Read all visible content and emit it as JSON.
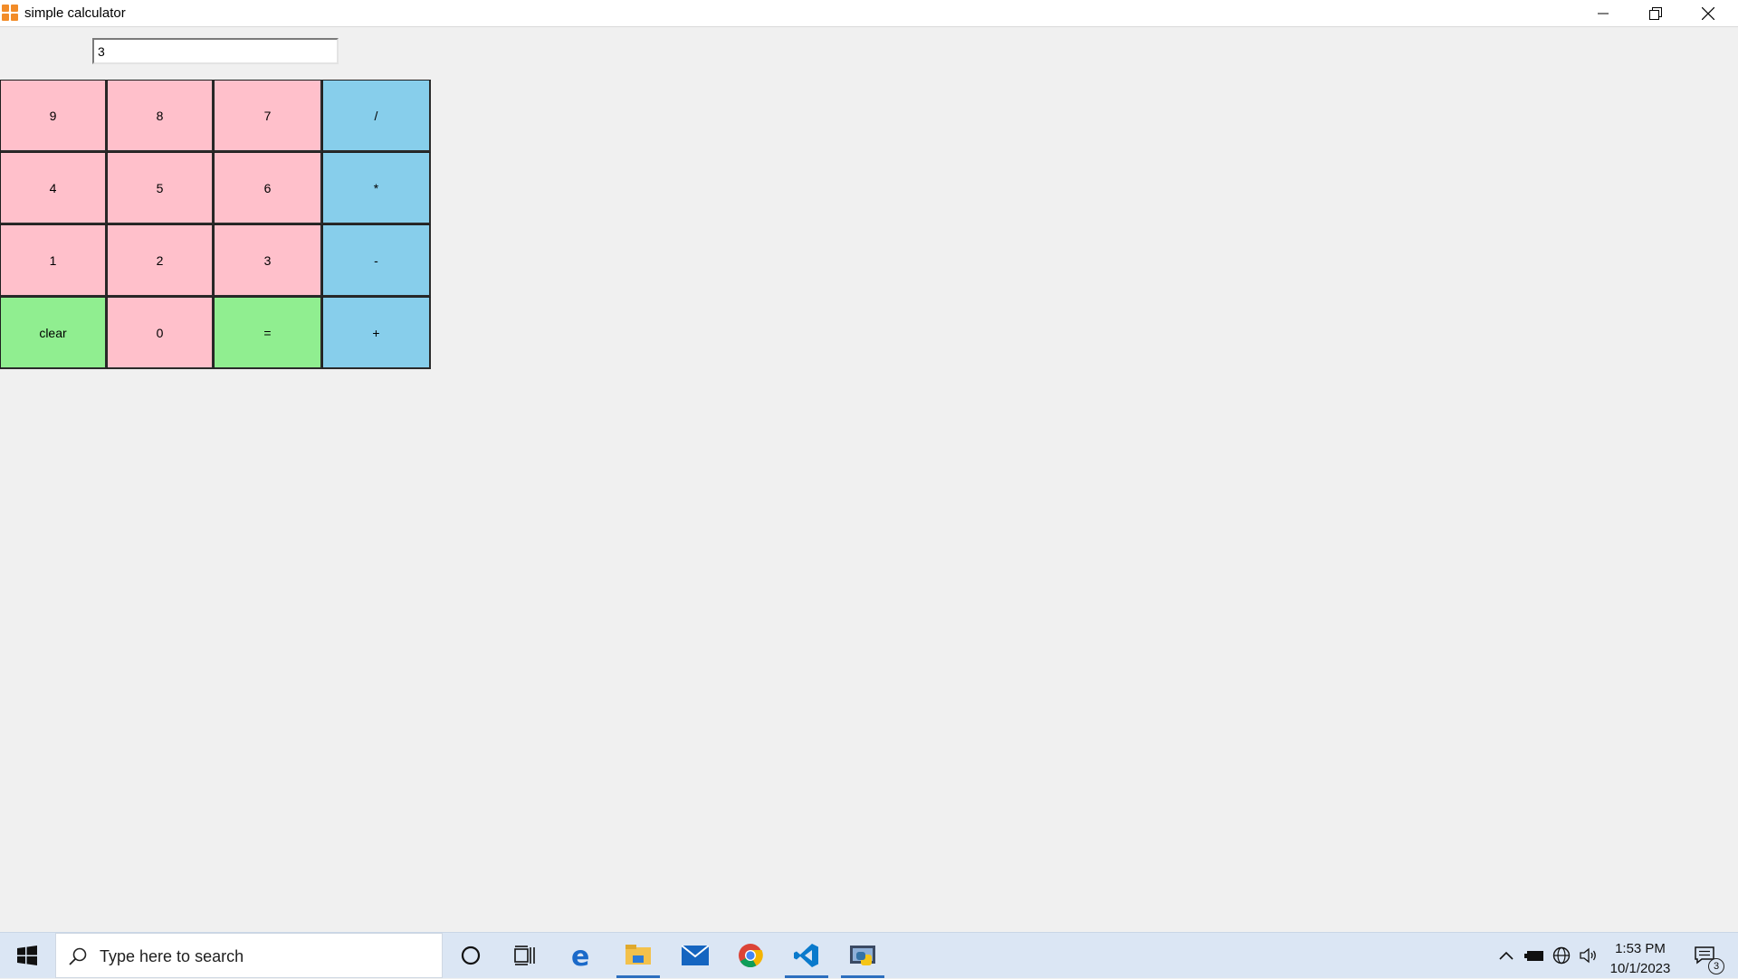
{
  "window": {
    "title": "simple calculator",
    "controls": [
      "minimize",
      "restore",
      "close"
    ]
  },
  "calculator": {
    "display_value": "3",
    "keys": [
      {
        "label": "9",
        "kind": "num"
      },
      {
        "label": "8",
        "kind": "num"
      },
      {
        "label": "7",
        "kind": "num"
      },
      {
        "label": "/",
        "kind": "op"
      },
      {
        "label": "4",
        "kind": "num"
      },
      {
        "label": "5",
        "kind": "num"
      },
      {
        "label": "6",
        "kind": "num"
      },
      {
        "label": "*",
        "kind": "op"
      },
      {
        "label": "1",
        "kind": "num"
      },
      {
        "label": "2",
        "kind": "num"
      },
      {
        "label": "3",
        "kind": "num"
      },
      {
        "label": "-",
        "kind": "op"
      },
      {
        "label": "clear",
        "kind": "act"
      },
      {
        "label": "0",
        "kind": "num"
      },
      {
        "label": "=",
        "kind": "act"
      },
      {
        "label": "+",
        "kind": "op"
      }
    ],
    "colors": {
      "num": "#ffc0cb",
      "op": "#87ceeb",
      "act": "#90ee90"
    }
  },
  "taskbar": {
    "search_placeholder": "Type here to search",
    "apps": [
      "cortana-icon",
      "task-view-icon",
      "edge-icon",
      "file-explorer-icon",
      "mail-icon",
      "chrome-icon",
      "vscode-icon",
      "python-app-icon"
    ],
    "time": "1:53 PM",
    "date": "10/1/2023",
    "notification_count": "3"
  }
}
